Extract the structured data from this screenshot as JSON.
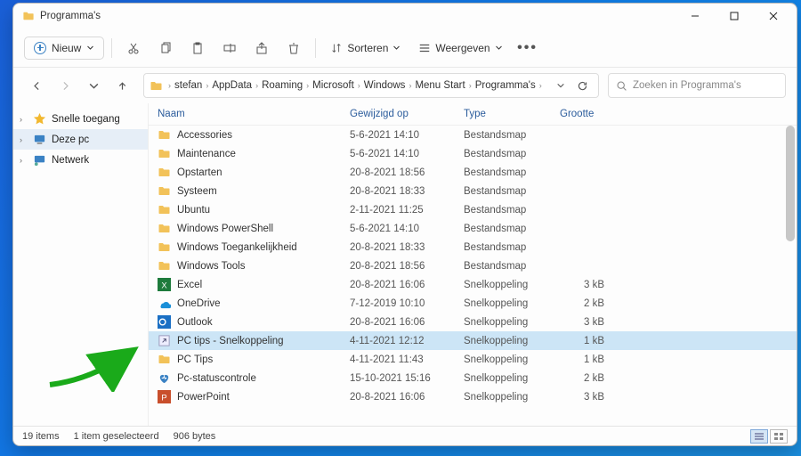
{
  "window": {
    "title": "Programma's"
  },
  "toolbar": {
    "new_label": "Nieuw",
    "sort_label": "Sorteren",
    "view_label": "Weergeven"
  },
  "breadcrumb": [
    "stefan",
    "AppData",
    "Roaming",
    "Microsoft",
    "Windows",
    "Menu Start",
    "Programma's"
  ],
  "search": {
    "placeholder": "Zoeken in Programma's"
  },
  "sidebar": {
    "items": [
      {
        "label": "Snelle toegang",
        "icon": "star"
      },
      {
        "label": "Deze pc",
        "icon": "pc",
        "selected": true
      },
      {
        "label": "Netwerk",
        "icon": "network"
      }
    ]
  },
  "columns": {
    "name": "Naam",
    "modified": "Gewijzigd op",
    "type": "Type",
    "size": "Grootte"
  },
  "files": [
    {
      "name": "Accessories",
      "mod": "5-6-2021 14:10",
      "type": "Bestandsmap",
      "size": "",
      "icon": "folder"
    },
    {
      "name": "Maintenance",
      "mod": "5-6-2021 14:10",
      "type": "Bestandsmap",
      "size": "",
      "icon": "folder"
    },
    {
      "name": "Opstarten",
      "mod": "20-8-2021 18:56",
      "type": "Bestandsmap",
      "size": "",
      "icon": "folder"
    },
    {
      "name": "Systeem",
      "mod": "20-8-2021 18:33",
      "type": "Bestandsmap",
      "size": "",
      "icon": "folder"
    },
    {
      "name": "Ubuntu",
      "mod": "2-11-2021 11:25",
      "type": "Bestandsmap",
      "size": "",
      "icon": "folder"
    },
    {
      "name": "Windows PowerShell",
      "mod": "5-6-2021 14:10",
      "type": "Bestandsmap",
      "size": "",
      "icon": "folder"
    },
    {
      "name": "Windows Toegankelijkheid",
      "mod": "20-8-2021 18:33",
      "type": "Bestandsmap",
      "size": "",
      "icon": "folder"
    },
    {
      "name": "Windows Tools",
      "mod": "20-8-2021 18:56",
      "type": "Bestandsmap",
      "size": "",
      "icon": "folder"
    },
    {
      "name": "Excel",
      "mod": "20-8-2021 16:06",
      "type": "Snelkoppeling",
      "size": "3 kB",
      "icon": "excel"
    },
    {
      "name": "OneDrive",
      "mod": "7-12-2019 10:10",
      "type": "Snelkoppeling",
      "size": "2 kB",
      "icon": "onedrive"
    },
    {
      "name": "Outlook",
      "mod": "20-8-2021 16:06",
      "type": "Snelkoppeling",
      "size": "3 kB",
      "icon": "outlook"
    },
    {
      "name": "PC tips - Snelkoppeling",
      "mod": "4-11-2021 12:12",
      "type": "Snelkoppeling",
      "size": "1 kB",
      "icon": "shortcut",
      "selected": true
    },
    {
      "name": "PC Tips",
      "mod": "4-11-2021 11:43",
      "type": "Snelkoppeling",
      "size": "1 kB",
      "icon": "folder"
    },
    {
      "name": "Pc-statuscontrole",
      "mod": "15-10-2021 15:16",
      "type": "Snelkoppeling",
      "size": "2 kB",
      "icon": "health"
    },
    {
      "name": "PowerPoint",
      "mod": "20-8-2021 16:06",
      "type": "Snelkoppeling",
      "size": "3 kB",
      "icon": "ppt"
    }
  ],
  "status": {
    "count": "19 items",
    "selected": "1 item geselecteerd",
    "size": "906 bytes"
  }
}
